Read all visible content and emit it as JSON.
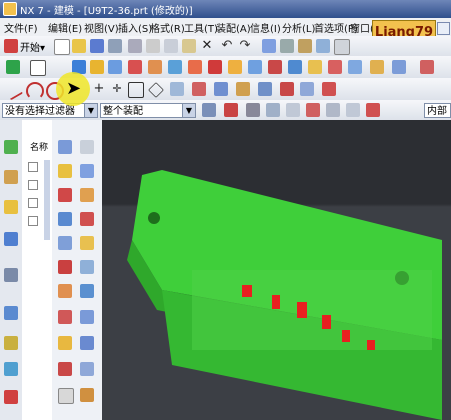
{
  "window": {
    "title": "NX 7 - 建模 - [U9T2-36.prt  (修改的)]"
  },
  "menu": [
    "文件(F)",
    "编辑(E)",
    "视图(V)",
    "插入(S)",
    "格式(R)",
    "工具(T)",
    "装配(A)",
    "信息(I)",
    "分析(L)",
    "首选项(P)",
    "窗口(O)"
  ],
  "watermark": "Liang79",
  "toolbar": {
    "start_label": "开始▾"
  },
  "filter": {
    "selection_filter": "没有选择过滤器",
    "assembly_scope": "整个装配",
    "snap_mode": "内部"
  },
  "navigator": {
    "column_header": "名称"
  },
  "colors": {
    "part_green": "#3fcf3a",
    "highlight_red": "#e82020",
    "background_dark": "#2c2e33"
  }
}
